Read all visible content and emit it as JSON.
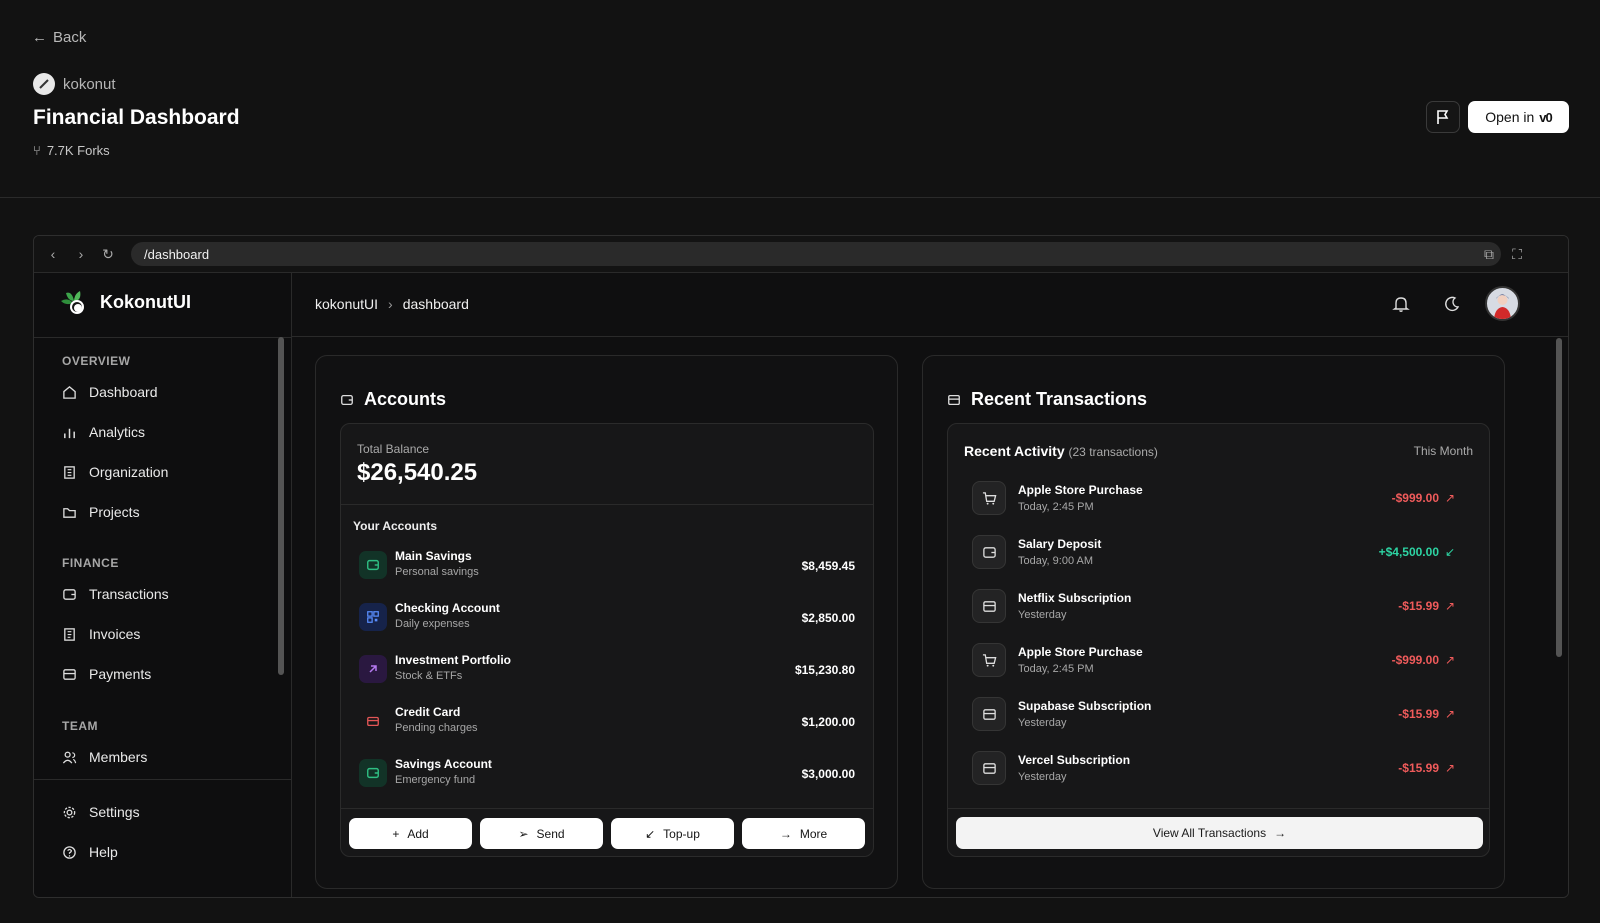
{
  "top": {
    "back_label": "Back",
    "org_name": "kokonut",
    "title": "Financial Dashboard",
    "forks": "7.7K Forks",
    "open_label": "Open in",
    "v0_mark": "v0"
  },
  "browser": {
    "url": "/dashboard"
  },
  "sidebar": {
    "brand": "KokonutUI",
    "sections": [
      {
        "label": "OVERVIEW",
        "items": [
          {
            "label": "Dashboard",
            "icon": "home-icon"
          },
          {
            "label": "Analytics",
            "icon": "bar-chart-icon"
          },
          {
            "label": "Organization",
            "icon": "building-icon"
          },
          {
            "label": "Projects",
            "icon": "folder-icon"
          }
        ]
      },
      {
        "label": "FINANCE",
        "items": [
          {
            "label": "Transactions",
            "icon": "wallet-icon"
          },
          {
            "label": "Invoices",
            "icon": "receipt-icon"
          },
          {
            "label": "Payments",
            "icon": "credit-card-icon"
          }
        ]
      },
      {
        "label": "TEAM",
        "items": [
          {
            "label": "Members",
            "icon": "users-icon"
          }
        ]
      }
    ],
    "footer": [
      {
        "label": "Settings",
        "icon": "gear-icon"
      },
      {
        "label": "Help",
        "icon": "help-circle-icon"
      }
    ]
  },
  "header": {
    "crumbs": [
      "kokonutUI",
      "dashboard"
    ]
  },
  "accounts": {
    "title": "Accounts",
    "total_label": "Total Balance",
    "total": "$26,540.25",
    "your_accounts": "Your Accounts",
    "items": [
      {
        "name": "Main Savings",
        "desc": "Personal savings",
        "amount": "$8,459.45",
        "color": "#1f9d6b"
      },
      {
        "name": "Checking Account",
        "desc": "Daily expenses",
        "amount": "$2,850.00",
        "color": "#3c7df0"
      },
      {
        "name": "Investment Portfolio",
        "desc": "Stock & ETFs",
        "amount": "$15,230.80",
        "color": "#a05ce0"
      },
      {
        "name": "Credit Card",
        "desc": "Pending charges",
        "amount": "$1,200.00",
        "color": "#e35656"
      },
      {
        "name": "Savings Account",
        "desc": "Emergency fund",
        "amount": "$3,000.00",
        "color": "#1f9d6b"
      }
    ],
    "buttons": [
      "Add",
      "Send",
      "Top-up",
      "More"
    ]
  },
  "transactions": {
    "title": "Recent Transactions",
    "activity_label": "Recent Activity",
    "count": "(23 transactions)",
    "period": "This Month",
    "items": [
      {
        "name": "Apple Store Purchase",
        "time": "Today, 2:45 PM",
        "amount": "-$999.00",
        "dir": "out",
        "icon": "cart-icon"
      },
      {
        "name": "Salary Deposit",
        "time": "Today, 9:00 AM",
        "amount": "+$4,500.00",
        "dir": "in",
        "icon": "wallet-icon"
      },
      {
        "name": "Netflix Subscription",
        "time": "Yesterday",
        "amount": "-$15.99",
        "dir": "out",
        "icon": "credit-card-icon"
      },
      {
        "name": "Apple Store Purchase",
        "time": "Today, 2:45 PM",
        "amount": "-$999.00",
        "dir": "out",
        "icon": "cart-icon"
      },
      {
        "name": "Supabase Subscription",
        "time": "Yesterday",
        "amount": "-$15.99",
        "dir": "out",
        "icon": "credit-card-icon"
      },
      {
        "name": "Vercel Subscription",
        "time": "Yesterday",
        "amount": "-$15.99",
        "dir": "out",
        "icon": "credit-card-icon"
      }
    ],
    "view_all": "View All Transactions"
  },
  "colors": {
    "positive": "#2dd4a3",
    "negative": "#f05b5b",
    "background": "#121212"
  }
}
